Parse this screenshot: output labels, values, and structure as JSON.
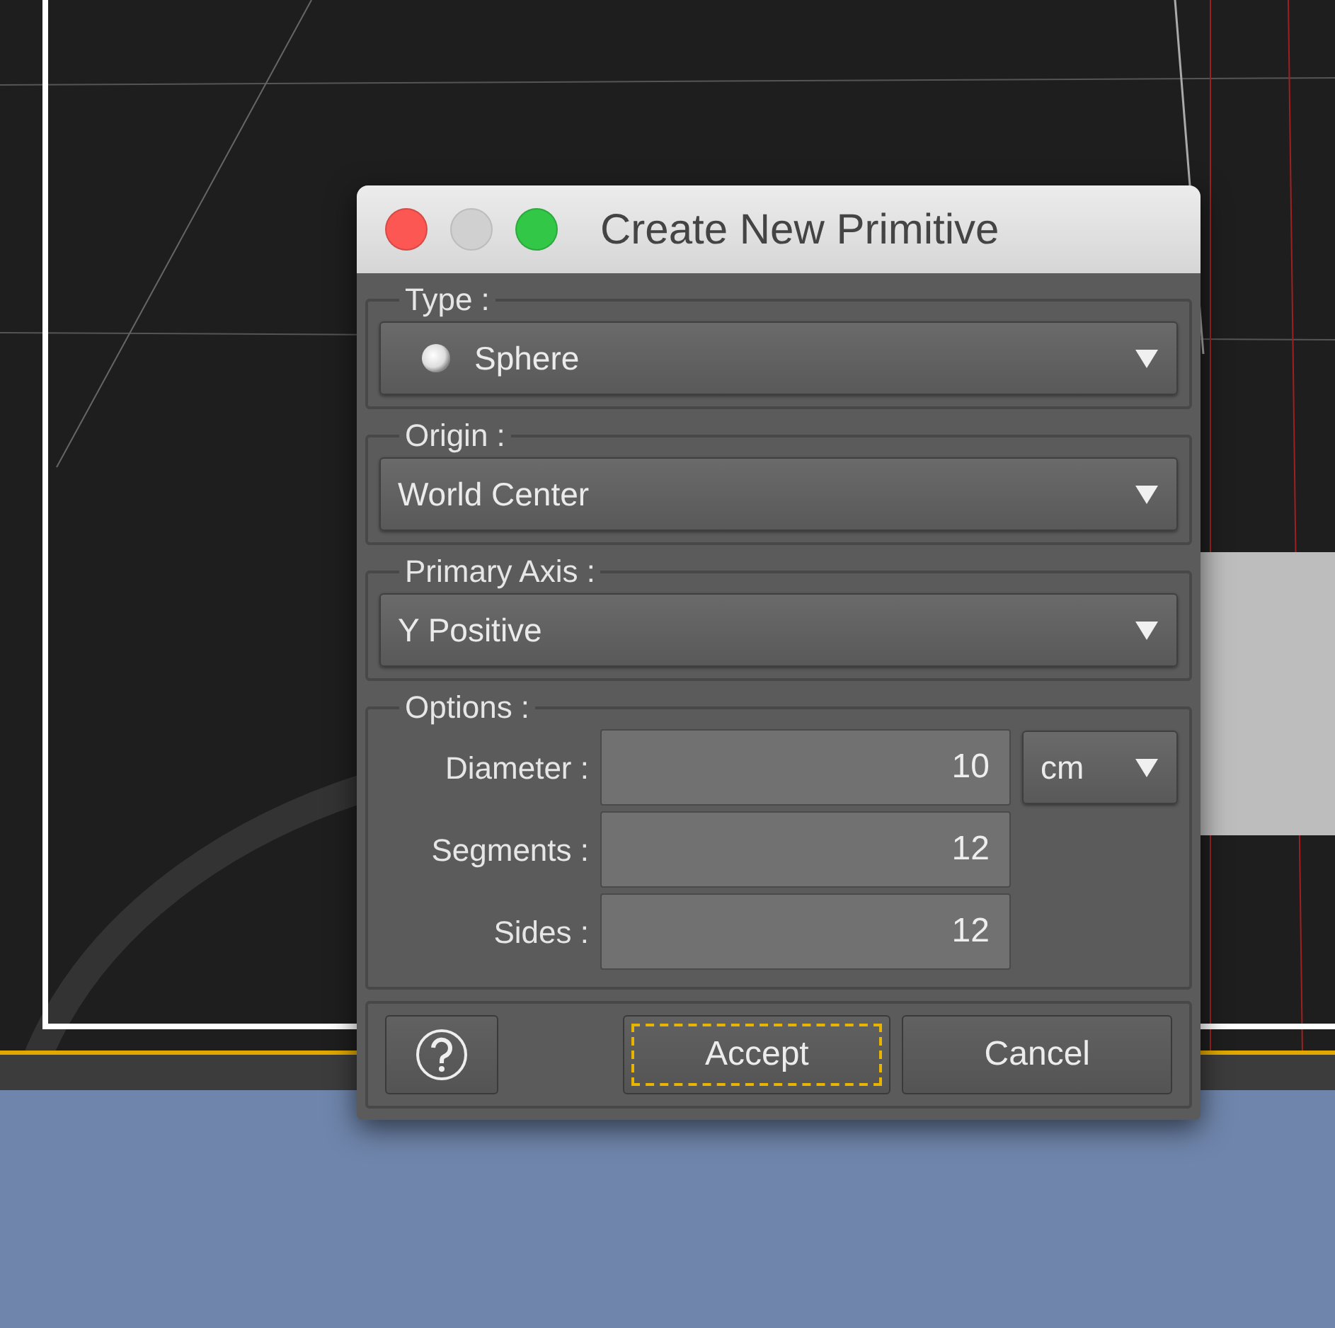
{
  "window": {
    "title": "Create New Primitive",
    "controls": [
      {
        "kind": "close",
        "disabled": false
      },
      {
        "kind": "minimize",
        "disabled": true
      },
      {
        "kind": "zoom",
        "disabled": false
      }
    ]
  },
  "selects": [
    {
      "legend": "Type :",
      "value": "Sphere",
      "kind": "icon-select"
    },
    {
      "legend": "Origin :",
      "value": "World Center",
      "kind": "select"
    },
    {
      "legend": "Primary Axis :",
      "value": "Y Positive",
      "kind": "select"
    }
  ],
  "options": {
    "legend": "Options :",
    "rows": [
      {
        "label": "Diameter :",
        "value": "10",
        "unit": "cm"
      },
      {
        "label": "Segments :",
        "value": "12"
      },
      {
        "label": "Sides :",
        "value": "12"
      }
    ]
  },
  "buttons": [
    {
      "kind": "help",
      "focused": false
    },
    {
      "kind": "text",
      "label": "Accept",
      "focused": true
    },
    {
      "kind": "text",
      "label": "Cancel",
      "focused": false
    }
  ]
}
